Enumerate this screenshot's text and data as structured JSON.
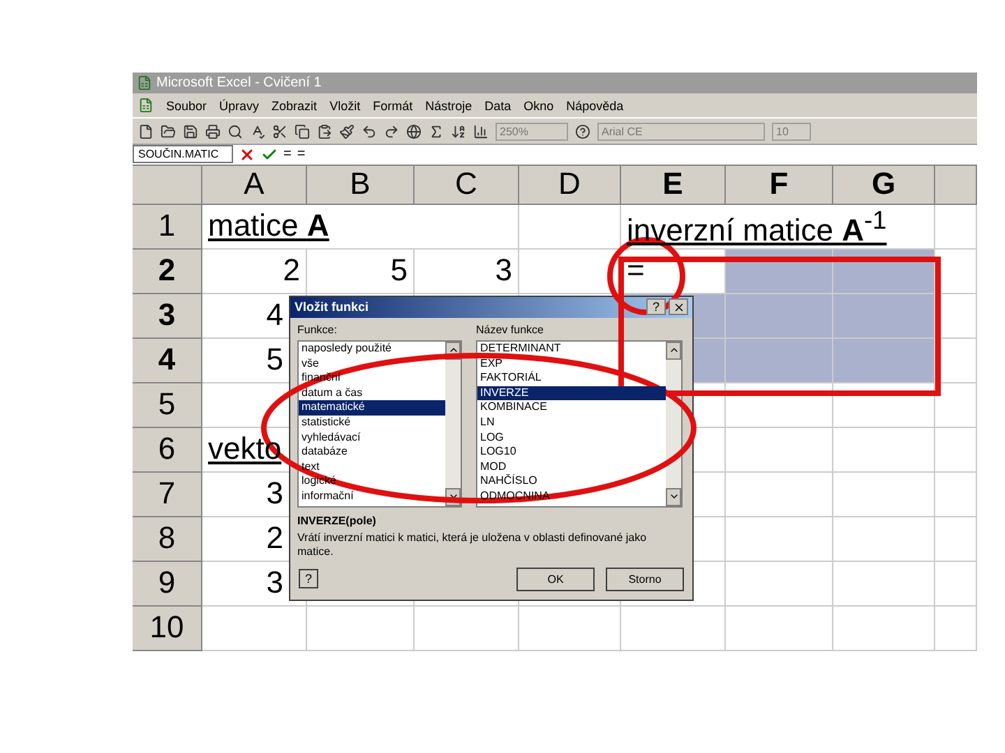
{
  "window": {
    "title": "Microsoft Excel - Cvičení 1"
  },
  "menu": [
    "Soubor",
    "Úpravy",
    "Zobrazit",
    "Vložit",
    "Formát",
    "Nástroje",
    "Data",
    "Okno",
    "Nápověda"
  ],
  "toolbar": {
    "zoom": "250%",
    "font": "Arial CE",
    "size": "10"
  },
  "formula_bar": {
    "name_box": "SOUČIN.MATIC",
    "label": "=",
    "value": "="
  },
  "columns": [
    {
      "label": "A",
      "selected": false
    },
    {
      "label": "B",
      "selected": false
    },
    {
      "label": "C",
      "selected": false
    },
    {
      "label": "D",
      "selected": false
    },
    {
      "label": "E",
      "selected": true
    },
    {
      "label": "F",
      "selected": true
    },
    {
      "label": "G",
      "selected": true
    }
  ],
  "rows": [
    {
      "label": "1",
      "selected": false,
      "cells": [
        {
          "text": "matice **A**",
          "kind": "heading"
        },
        null,
        null,
        null,
        {
          "text": "inverzní matice **A**$^{-1}$",
          "kind": "heading"
        },
        null,
        null
      ]
    },
    {
      "label": "2",
      "selected": true,
      "cells": [
        {
          "text": "2",
          "kind": "number"
        },
        {
          "text": "5",
          "kind": "number"
        },
        {
          "text": "3",
          "kind": "number"
        },
        null,
        {
          "text": "=",
          "kind": "input"
        },
        null,
        null
      ]
    },
    {
      "label": "3",
      "selected": true,
      "cells": [
        {
          "text": "4",
          "kind": "number"
        },
        null,
        null,
        null,
        null,
        null,
        null
      ]
    },
    {
      "label": "4",
      "selected": true,
      "cells": [
        {
          "text": "5",
          "kind": "number"
        },
        null,
        null,
        null,
        null,
        null,
        null
      ]
    },
    {
      "label": "5",
      "selected": false,
      "cells": [
        null,
        null,
        null,
        null,
        null,
        null,
        null
      ]
    },
    {
      "label": "6",
      "selected": false,
      "cells": [
        {
          "text": "vekto",
          "kind": "heading"
        },
        null,
        null,
        null,
        null,
        null,
        null
      ]
    },
    {
      "label": "7",
      "selected": false,
      "cells": [
        {
          "text": "3",
          "kind": "number"
        },
        null,
        null,
        null,
        null,
        null,
        null
      ]
    },
    {
      "label": "8",
      "selected": false,
      "cells": [
        {
          "text": "2",
          "kind": "number"
        },
        null,
        null,
        null,
        null,
        null,
        null
      ]
    },
    {
      "label": "9",
      "selected": false,
      "cells": [
        {
          "text": "3",
          "kind": "number"
        },
        null,
        null,
        null,
        null,
        null,
        null
      ]
    },
    {
      "label": "10",
      "selected": false,
      "cells": [
        null,
        null,
        null,
        null,
        null,
        null,
        null
      ]
    }
  ],
  "dialog": {
    "title": "Vložit funkci",
    "categories_label": "Funkce:",
    "functions_label": "Název funkce",
    "categories": [
      {
        "label": "naposledy použité",
        "selected": false
      },
      {
        "label": "vše",
        "selected": false
      },
      {
        "label": "finanční",
        "selected": false
      },
      {
        "label": "datum a čas",
        "selected": false
      },
      {
        "label": "matematické",
        "selected": true
      },
      {
        "label": "statistické",
        "selected": false
      },
      {
        "label": "vyhledávací",
        "selected": false
      },
      {
        "label": "databáze",
        "selected": false
      },
      {
        "label": "text",
        "selected": false
      },
      {
        "label": "logické",
        "selected": false
      },
      {
        "label": "informační",
        "selected": false
      }
    ],
    "functions": [
      {
        "label": "DETERMINANT",
        "selected": false
      },
      {
        "label": "EXP",
        "selected": false
      },
      {
        "label": "FAKTORIÁL",
        "selected": false
      },
      {
        "label": "INVERZE",
        "selected": true
      },
      {
        "label": "KOMBINACE",
        "selected": false
      },
      {
        "label": "LN",
        "selected": false
      },
      {
        "label": "LOG",
        "selected": false
      },
      {
        "label": "LOG10",
        "selected": false
      },
      {
        "label": "MOD",
        "selected": false
      },
      {
        "label": "NAHČÍSLO",
        "selected": false
      },
      {
        "label": "ODMOCNINA",
        "selected": false
      }
    ],
    "syntax": "INVERZE(pole)",
    "description": "Vrátí inverzní matici k matici, která je uložena v oblasti definované jako matice.",
    "help": "?",
    "ok": "OK",
    "cancel": "Storno"
  }
}
